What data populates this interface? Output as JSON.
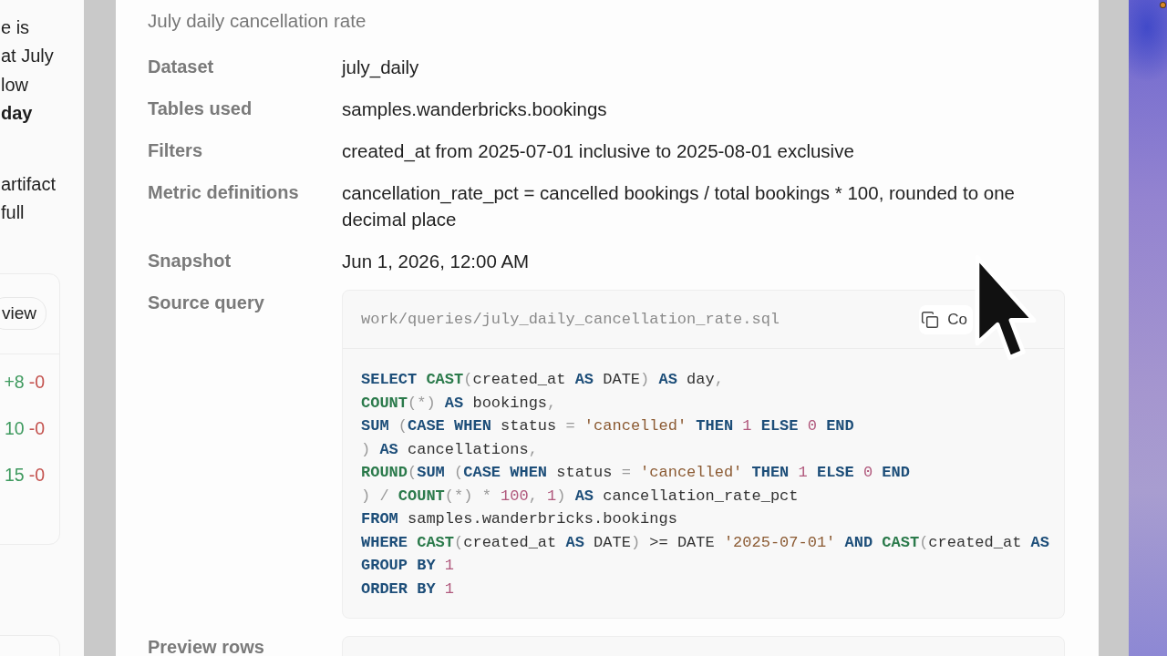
{
  "background_page": {
    "paragraphs": [
      "e is\nat July\nlow\n**day**",
      "artifact\nfull"
    ],
    "changes_card": {
      "button": "view",
      "rows": [
        {
          "added": "+8",
          "removed": "-0"
        },
        {
          "added": "10",
          "removed": "-0"
        },
        {
          "added": "15",
          "removed": "-0"
        }
      ]
    }
  },
  "dialog": {
    "title": "July daily cancellation rate",
    "details": [
      {
        "label": "Dataset",
        "value": "july_daily"
      },
      {
        "label": "Tables used",
        "value": "samples.wanderbricks.bookings"
      },
      {
        "label": "Filters",
        "value": "created_at from 2025-07-01 inclusive to 2025-08-01 exclusive"
      },
      {
        "label": "Metric definitions",
        "value": "cancellation_rate_pct = cancelled bookings / total bookings * 100, rounded to one decimal place"
      },
      {
        "label": "Snapshot",
        "value": "Jun 1, 2026, 12:00 AM"
      }
    ],
    "source_query": {
      "label": "Source query",
      "path": "work/queries/july_daily_cancellation_rate.sql",
      "copy_button": "Co",
      "code_lines": [
        [
          {
            "kind": "keyword",
            "text": "SELECT "
          },
          {
            "kind": "function",
            "text": "CAST"
          },
          {
            "kind": "punctuation",
            "text": "("
          },
          {
            "kind": "plain",
            "text": "created_at "
          },
          {
            "kind": "keyword",
            "text": "AS"
          },
          {
            "kind": "plain",
            "text": " DATE"
          },
          {
            "kind": "punctuation",
            "text": ")"
          },
          {
            "kind": "keyword",
            "text": " AS"
          },
          {
            "kind": "plain",
            "text": " day"
          },
          {
            "kind": "punctuation",
            "text": ","
          }
        ],
        [
          {
            "kind": "function",
            "text": "COUNT"
          },
          {
            "kind": "punctuation",
            "text": "(*)"
          },
          {
            "kind": "keyword",
            "text": " AS"
          },
          {
            "kind": "plain",
            "text": " bookings"
          },
          {
            "kind": "punctuation",
            "text": ","
          }
        ],
        [
          {
            "kind": "keyword",
            "text": "SUM "
          },
          {
            "kind": "punctuation",
            "text": "("
          },
          {
            "kind": "keyword",
            "text": "CASE WHEN"
          },
          {
            "kind": "plain",
            "text": " status "
          },
          {
            "kind": "punctuation",
            "text": "="
          },
          {
            "kind": "string",
            "text": " 'cancelled'"
          },
          {
            "kind": "keyword",
            "text": " THEN"
          },
          {
            "kind": "number",
            "text": " 1"
          },
          {
            "kind": "keyword",
            "text": " ELSE"
          },
          {
            "kind": "number",
            "text": " 0"
          },
          {
            "kind": "keyword",
            "text": " END"
          }
        ],
        [
          {
            "kind": "punctuation",
            "text": ")"
          },
          {
            "kind": "keyword",
            "text": " AS"
          },
          {
            "kind": "plain",
            "text": " cancellations"
          },
          {
            "kind": "punctuation",
            "text": ","
          }
        ],
        [
          {
            "kind": "function",
            "text": "ROUND"
          },
          {
            "kind": "punctuation",
            "text": "("
          },
          {
            "kind": "keyword",
            "text": "SUM "
          },
          {
            "kind": "punctuation",
            "text": "("
          },
          {
            "kind": "keyword",
            "text": "CASE WHEN"
          },
          {
            "kind": "plain",
            "text": " status "
          },
          {
            "kind": "punctuation",
            "text": "="
          },
          {
            "kind": "string",
            "text": " 'cancelled'"
          },
          {
            "kind": "keyword",
            "text": " THEN"
          },
          {
            "kind": "number",
            "text": " 1"
          },
          {
            "kind": "keyword",
            "text": " ELSE"
          },
          {
            "kind": "number",
            "text": " 0"
          },
          {
            "kind": "keyword",
            "text": " END"
          }
        ],
        [
          {
            "kind": "punctuation",
            "text": ") / "
          },
          {
            "kind": "function",
            "text": "COUNT"
          },
          {
            "kind": "punctuation",
            "text": "(*) * "
          },
          {
            "kind": "number",
            "text": "100"
          },
          {
            "kind": "punctuation",
            "text": ", "
          },
          {
            "kind": "number",
            "text": "1"
          },
          {
            "kind": "punctuation",
            "text": ")"
          },
          {
            "kind": "keyword",
            "text": " AS"
          },
          {
            "kind": "plain",
            "text": " cancellation_rate_pct"
          }
        ],
        [
          {
            "kind": "keyword",
            "text": "FROM"
          },
          {
            "kind": "plain",
            "text": " samples.wanderbricks.bookings"
          }
        ],
        [
          {
            "kind": "keyword",
            "text": "WHERE "
          },
          {
            "kind": "function",
            "text": "CAST"
          },
          {
            "kind": "punctuation",
            "text": "("
          },
          {
            "kind": "plain",
            "text": "created_at "
          },
          {
            "kind": "keyword",
            "text": "AS"
          },
          {
            "kind": "plain",
            "text": " DATE"
          },
          {
            "kind": "punctuation",
            "text": ")"
          },
          {
            "kind": "plain",
            "text": " >= DATE "
          },
          {
            "kind": "string",
            "text": "'2025-07-01'"
          },
          {
            "kind": "keyword",
            "text": " AND "
          },
          {
            "kind": "function",
            "text": "CAST"
          },
          {
            "kind": "punctuation",
            "text": "("
          },
          {
            "kind": "plain",
            "text": "created_at "
          },
          {
            "kind": "keyword",
            "text": "AS"
          }
        ],
        [
          {
            "kind": "keyword",
            "text": "GROUP BY"
          },
          {
            "kind": "number",
            "text": " 1"
          }
        ],
        [
          {
            "kind": "keyword",
            "text": "ORDER BY"
          },
          {
            "kind": "number",
            "text": " 1"
          }
        ]
      ]
    },
    "preview_rows": {
      "label": "Preview rows"
    }
  }
}
